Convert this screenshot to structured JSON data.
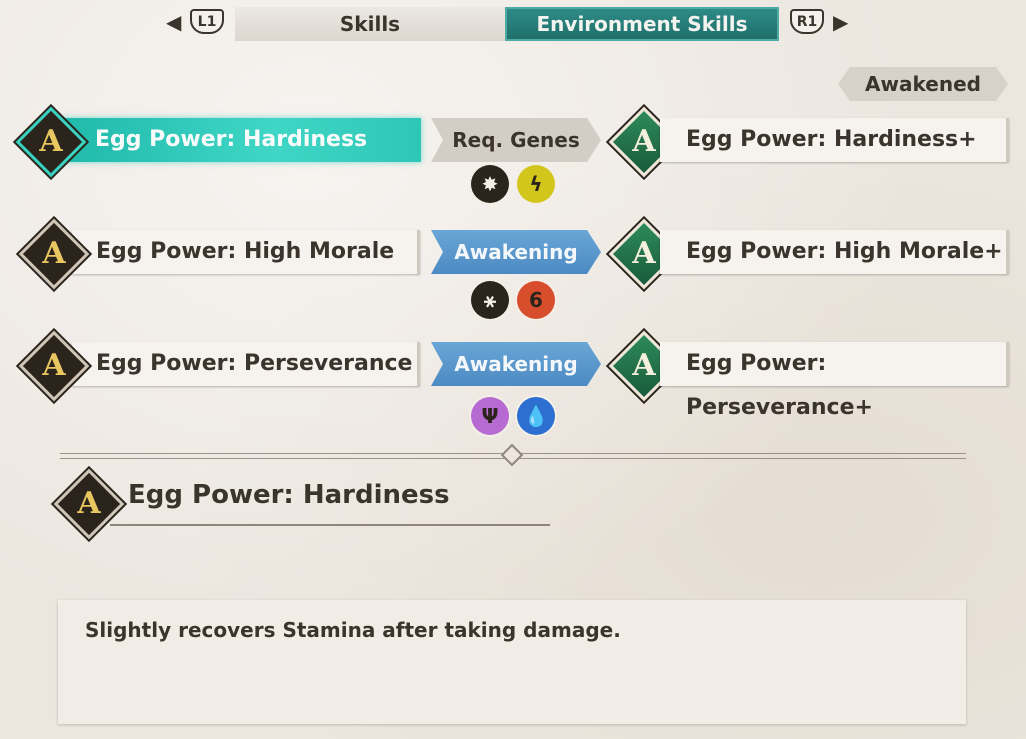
{
  "tabs": {
    "left_button": "L1",
    "right_button": "R1",
    "items": [
      "Skills",
      "Environment Skills"
    ],
    "active_index": 1
  },
  "awakened_label": "Awakened",
  "rows": [
    {
      "skill": "Egg Power: Hardiness",
      "selected": true,
      "middle_label": "Req. Genes",
      "middle_type": "req",
      "genes": [
        {
          "icon": "burst-icon",
          "glyph": "✸",
          "color": "#2b241d"
        },
        {
          "icon": "lightning-icon",
          "glyph": "ϟ",
          "color": "#d2c51c"
        }
      ],
      "result": "Egg Power: Hardiness+"
    },
    {
      "skill": "Egg Power: High Morale",
      "selected": false,
      "middle_label": "Awakening",
      "middle_type": "awk",
      "genes": [
        {
          "icon": "running-icon",
          "glyph": "⚹",
          "color": "#2b241d"
        },
        {
          "icon": "fire-icon",
          "glyph": "6",
          "color": "#d84e2c"
        }
      ],
      "result": "Egg Power: High Morale+"
    },
    {
      "skill": "Egg Power: Perseverance",
      "selected": false,
      "middle_label": "Awakening",
      "middle_type": "awk",
      "genes": [
        {
          "icon": "magnet-icon",
          "glyph": "Ψ",
          "color": "#b76ad1"
        },
        {
          "icon": "water-drop-icon",
          "glyph": "💧",
          "color": "#2d6fd0"
        }
      ],
      "result": "Egg Power: Perseverance+"
    }
  ],
  "detail": {
    "badge": "A",
    "title": "Egg Power: Hardiness",
    "description": "Slightly recovers Stamina after taking damage."
  }
}
